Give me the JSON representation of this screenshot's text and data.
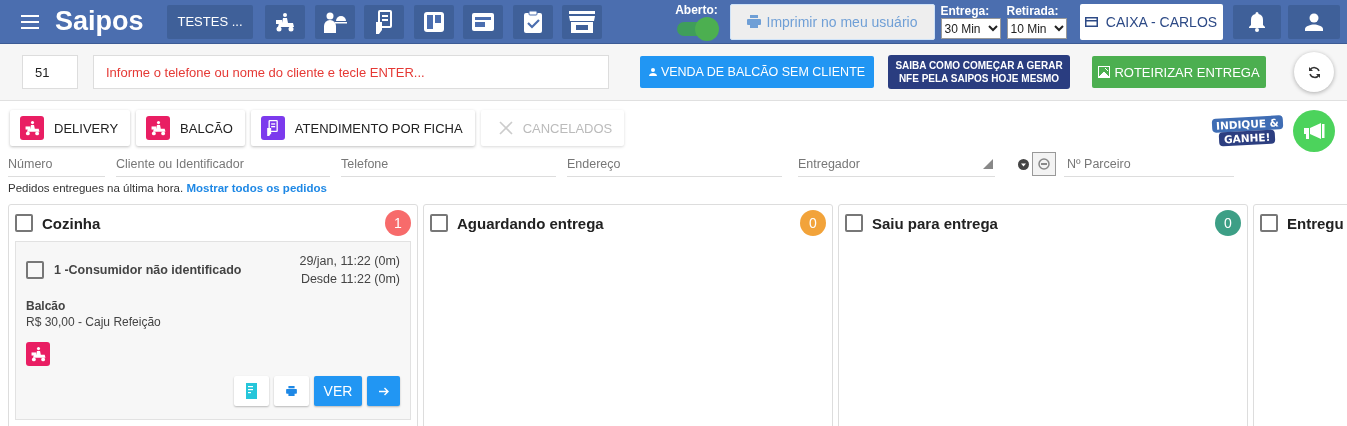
{
  "topbar": {
    "logo": "Saipos",
    "store_button": "TESTES ...",
    "open_toggle": {
      "label": "Aberto:",
      "on": true
    },
    "print_button": {
      "label": "Imprimir no meu usuário",
      "disabled": true
    },
    "delivery_time": {
      "label": "Entrega:",
      "value": "30 Min"
    },
    "pickup_time": {
      "label": "Retirada:",
      "value": "10 Min"
    },
    "cashier_button": "CAIXA - CARLOS"
  },
  "search": {
    "number": "51",
    "placeholder": "Informe o telefone ou nome do cliente e tecle ENTER..."
  },
  "counter_sale_button": "VENDA DE BALCÃO SEM CLIENTE",
  "nfe_banner": [
    "SAIBA COMO COMEÇAR A GERAR",
    "NFE PELA SAIPOS HOJE MESMO"
  ],
  "route_button": "ROTEIRIZAR ENTREGA",
  "type_tabs": [
    {
      "label": "DELIVERY",
      "kind": "delivery",
      "disabled": false
    },
    {
      "label": "BALCÃO",
      "kind": "counter",
      "disabled": false
    },
    {
      "label": "ATENDIMENTO POR FICHA",
      "kind": "ticket",
      "disabled": false
    },
    {
      "label": "CANCELADOS",
      "kind": "cancelled",
      "disabled": true
    }
  ],
  "referral_badge": [
    "INDIQUE &",
    "GANHE!"
  ],
  "filters": [
    {
      "placeholder": "Número",
      "kind": "text"
    },
    {
      "placeholder": "Cliente ou Identificador",
      "kind": "text"
    },
    {
      "placeholder": "Telefone",
      "kind": "text"
    },
    {
      "placeholder": "Endereço",
      "kind": "text"
    },
    {
      "placeholder": "Entregador",
      "kind": "select"
    },
    {
      "placeholder": "Nº Parceiro",
      "kind": "partner"
    }
  ],
  "info": {
    "text": "Pedidos entregues na última hora.",
    "link": "Mostrar todos os pedidos"
  },
  "columns": [
    {
      "title": "Cozinha",
      "checked": false,
      "count": "1",
      "color": "#f76b6b",
      "orders": [
        {
          "checked": false,
          "title": "1 -Consumidor não identificado",
          "date": "29/jan, 11:22 (0m)",
          "since": "Desde 11:22 (0m)",
          "type": "Balcão",
          "payment": "R$ 30,00 - Caju Refeição",
          "view_button": "VER"
        }
      ]
    },
    {
      "title": "Aguardando entrega",
      "checked": false,
      "count": "0",
      "color": "#f2a33a"
    },
    {
      "title": "Saiu para entrega",
      "checked": false,
      "count": "0",
      "color": "#3d9f86"
    },
    {
      "title": "Entregu",
      "checked": false
    }
  ]
}
